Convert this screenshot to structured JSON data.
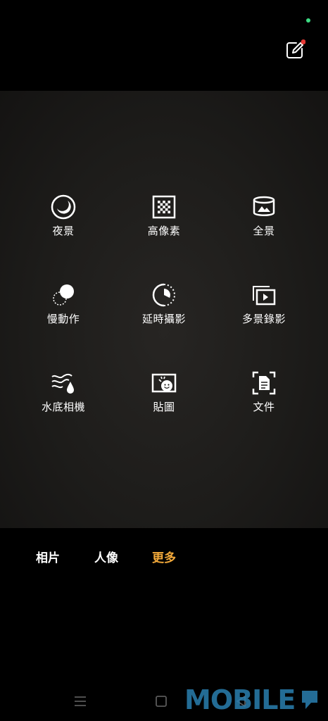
{
  "colors": {
    "accent": "#f3a93a",
    "notification_dot": "#e53935",
    "status_dot": "#3ddc84",
    "watermark": "#2a7fb0"
  },
  "toolbar": {
    "edit_icon": "edit-pencil-icon"
  },
  "modes": [
    {
      "label": "夜景",
      "icon": "night-mode-icon"
    },
    {
      "label": "高像素",
      "icon": "high-pixel-icon"
    },
    {
      "label": "全景",
      "icon": "panorama-icon"
    },
    {
      "label": "慢動作",
      "icon": "slow-motion-icon"
    },
    {
      "label": "延時攝影",
      "icon": "time-lapse-icon"
    },
    {
      "label": "多景錄影",
      "icon": "multi-scene-video-icon"
    },
    {
      "label": "水底相機",
      "icon": "underwater-camera-icon"
    },
    {
      "label": "貼圖",
      "icon": "sticker-icon"
    },
    {
      "label": "文件",
      "icon": "document-scan-icon"
    }
  ],
  "tabs": [
    {
      "label": "相片",
      "active": false
    },
    {
      "label": "人像",
      "active": false
    },
    {
      "label": "更多",
      "active": true
    }
  ],
  "nav": {
    "menu_icon": "menu-icon",
    "home_icon": "home-square-icon",
    "back_icon": "back-triangle-icon"
  },
  "watermark": {
    "text": "MOBILE"
  }
}
